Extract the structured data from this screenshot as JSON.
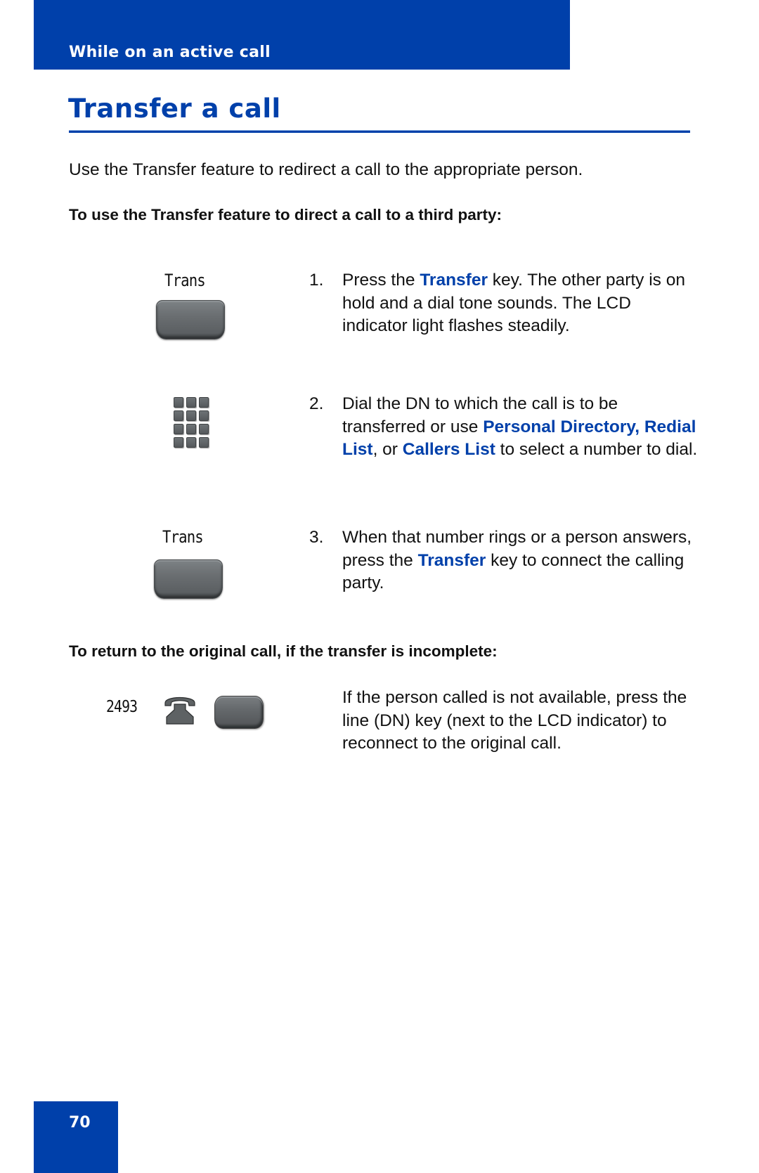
{
  "header": {
    "section_label": "While on an active call",
    "brand_color": "#0040AA"
  },
  "title": "Transfer a call",
  "intro": "Use the Transfer feature to redirect a call to the appropriate person.",
  "procedure_1": {
    "heading": "To use the Transfer feature to direct a call to a third party:",
    "steps": [
      {
        "number": "1.",
        "icon": "transfer-softkey",
        "key_label": "Trans",
        "parts": [
          {
            "text": "Press the "
          },
          {
            "text": "Transfer",
            "highlight": true
          },
          {
            "text": " key. The other party is on hold and a dial tone sounds. The LCD indicator light flashes steadily."
          }
        ]
      },
      {
        "number": "2.",
        "icon": "dialpad",
        "parts": [
          {
            "text": "Dial the DN to which the call is to be transferred or use "
          },
          {
            "text": "Personal Directory,",
            "highlight": true
          },
          {
            "text": " "
          },
          {
            "text": "Redial List",
            "highlight": true
          },
          {
            "text": ", or "
          },
          {
            "text": "Callers List",
            "highlight": true
          },
          {
            "text": " to select a number to dial."
          }
        ]
      },
      {
        "number": "3.",
        "icon": "transfer-softkey",
        "key_label": "Trans",
        "parts": [
          {
            "text": "When that number rings or a person answers, press the "
          },
          {
            "text": "Transfer",
            "highlight": true
          },
          {
            "text": " key to connect the calling party."
          }
        ]
      }
    ]
  },
  "procedure_2": {
    "heading": "To return to the original call, if the transfer is incomplete:",
    "dn_label": "2493",
    "icons": [
      "handset-icon",
      "line-key"
    ],
    "text": "If the person called is not available, press the line (DN) key (next to the LCD indicator) to reconnect to the original call."
  },
  "footer": {
    "page_number": "70"
  }
}
